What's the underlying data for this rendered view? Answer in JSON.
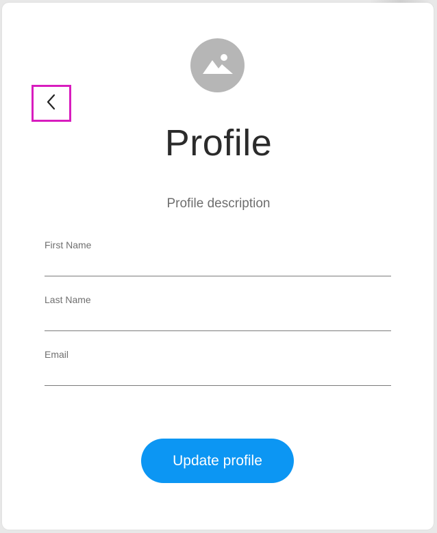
{
  "profile": {
    "title": "Profile",
    "description": "Profile description",
    "avatar_icon": "image-placeholder-icon",
    "back_icon": "chevron-left-icon"
  },
  "form": {
    "fields": [
      {
        "label": "First Name",
        "value": "",
        "placeholder": ""
      },
      {
        "label": "Last Name",
        "value": "",
        "placeholder": ""
      },
      {
        "label": "Email",
        "value": "",
        "placeholder": ""
      }
    ],
    "submit_label": "Update profile"
  },
  "colors": {
    "accent": "#0c96f3",
    "highlight_border": "#d81cbe",
    "avatar_bg": "#b6b6b6"
  }
}
